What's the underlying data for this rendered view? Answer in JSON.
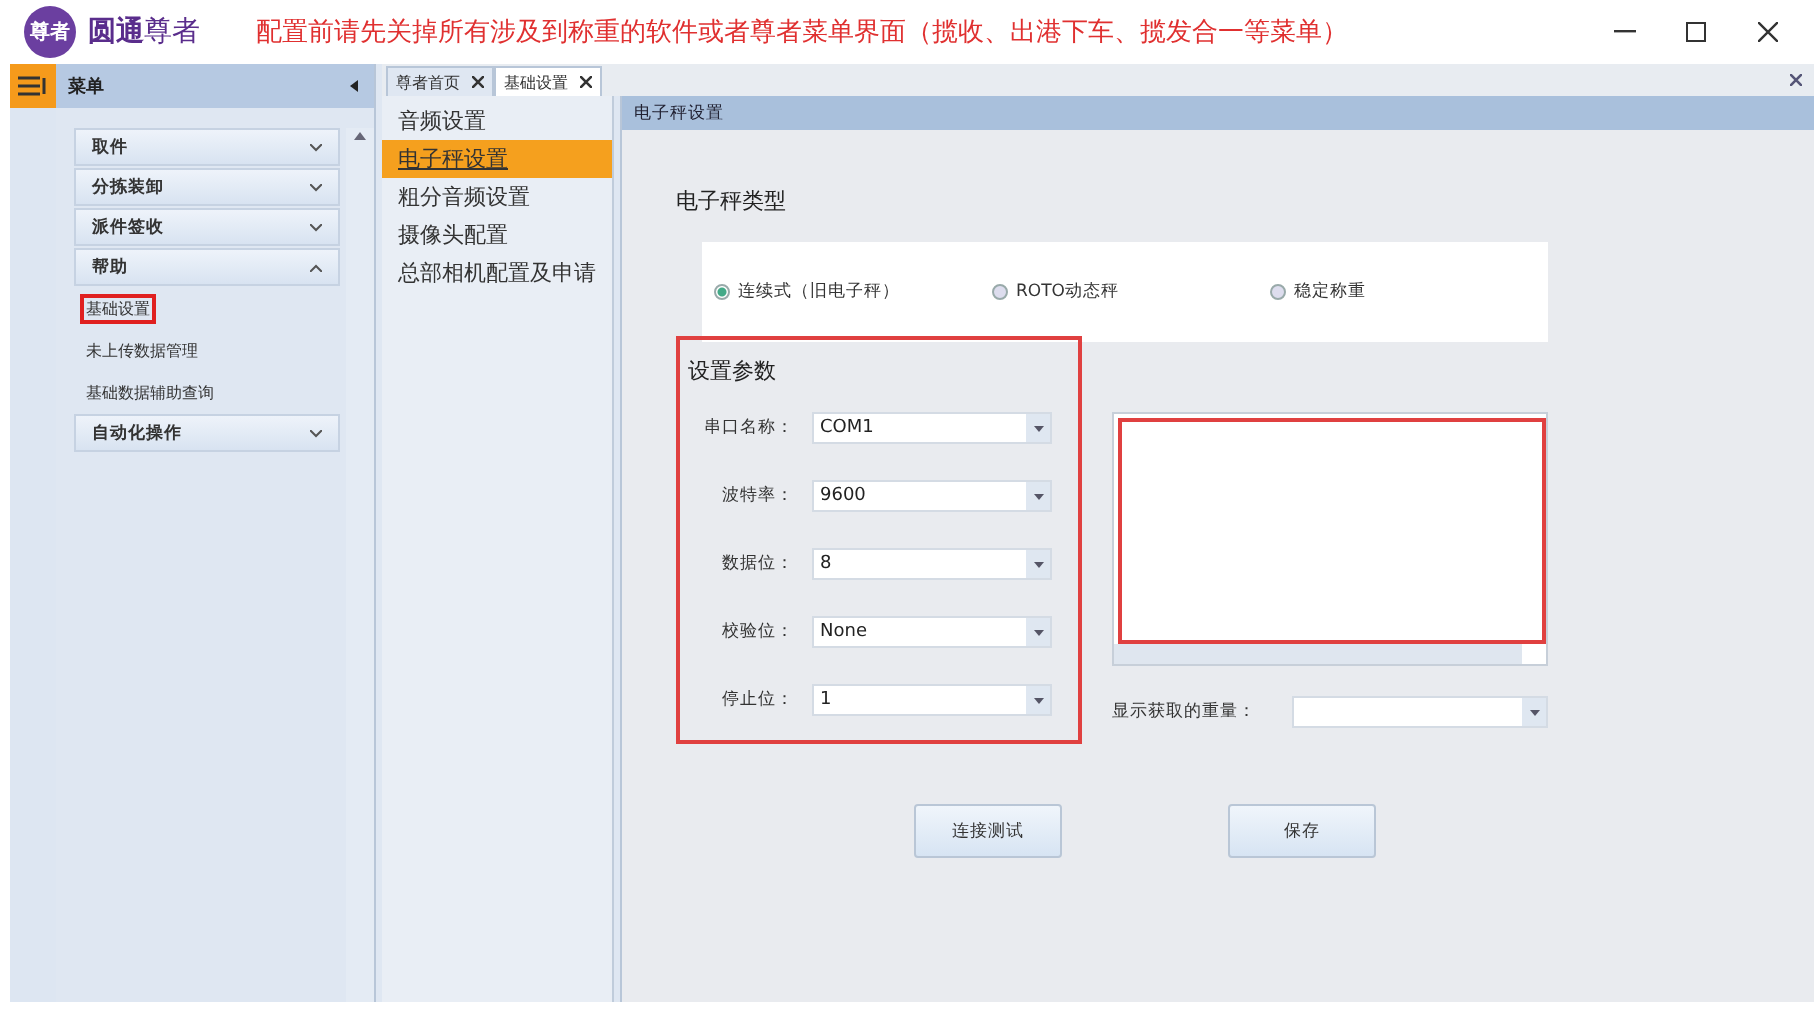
{
  "app": {
    "logo_text": "尊者",
    "name_bold": "圆通",
    "name_rest": "尊者"
  },
  "notice": "配置前请先关掉所有涉及到称重的软件或者尊者菜单界面（揽收、出港下车、揽发合一等菜单）",
  "sidebar": {
    "title": "菜单",
    "groups": [
      {
        "label": "取件",
        "expanded": false
      },
      {
        "label": "分拣装卸",
        "expanded": false
      },
      {
        "label": "派件签收",
        "expanded": false
      },
      {
        "label": "帮助",
        "expanded": true,
        "children": [
          {
            "label": "基础设置",
            "selected": true
          },
          {
            "label": "未上传数据管理",
            "selected": false
          },
          {
            "label": "基础数据辅助查询",
            "selected": false
          }
        ]
      },
      {
        "label": "自动化操作",
        "expanded": false
      }
    ]
  },
  "tabs": [
    {
      "label": "尊者首页",
      "selected": false
    },
    {
      "label": "基础设置",
      "selected": true
    }
  ],
  "settings_nav": [
    {
      "label": "音频设置",
      "selected": false
    },
    {
      "label": "电子秤设置",
      "selected": true
    },
    {
      "label": "粗分音频设置",
      "selected": false
    },
    {
      "label": "摄像头配置",
      "selected": false
    },
    {
      "label": "总部相机配置及申请",
      "selected": false
    }
  ],
  "panel": {
    "title": "电子秤设置",
    "type_heading": "电子秤类型",
    "scale_types": [
      {
        "label": "连续式（旧电子秤）",
        "selected": true
      },
      {
        "label": "ROTO动态秤",
        "selected": false
      },
      {
        "label": "稳定称重",
        "selected": false
      }
    ],
    "params_heading": "设置参数",
    "params": [
      {
        "label": "串口名称：",
        "value": "COM1"
      },
      {
        "label": "波特率：",
        "value": "9600"
      },
      {
        "label": "数据位：",
        "value": "8"
      },
      {
        "label": "校验位：",
        "value": "None"
      },
      {
        "label": "停止位：",
        "value": "1"
      }
    ],
    "weight_label": "显示获取的重量：",
    "buttons": [
      "连接测试",
      "保存"
    ]
  }
}
